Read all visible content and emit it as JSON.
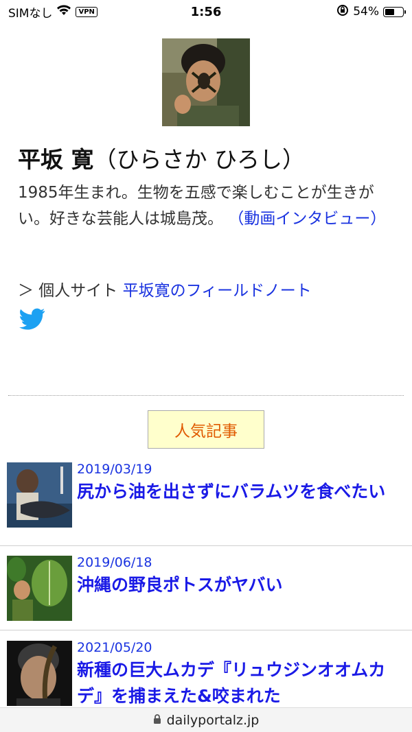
{
  "status_bar": {
    "carrier": "SIMなし",
    "vpn": "VPN",
    "time": "1:56",
    "battery": "54%",
    "battery_level": 0.54
  },
  "profile": {
    "name": "平坂 寛",
    "reading": "（ひらさか ひろし）",
    "bio_text": "1985年生まれ。生物を五感で楽しむことが生きがい。好きな芸能人は城島茂。",
    "bio_link": "（動画インタビュー）",
    "site_prefix": "＞ 個人サイト",
    "site_link": "平坂寛のフィールドノート",
    "twitter_icon": "twitter-icon"
  },
  "popular": {
    "label": "人気記事"
  },
  "articles": [
    {
      "date": "2019/03/19",
      "title": "尻から油を出さずにバラムツを食べたい"
    },
    {
      "date": "2019/06/18",
      "title": "沖縄の野良ポトスがヤバい"
    },
    {
      "date": "2021/05/20",
      "title": "新種の巨大ムカデ『リュウジンオオムカデ』を捕まえた&咬まれた"
    }
  ],
  "url_bar": {
    "domain": "dailyportalz.jp",
    "icon": "lock-icon"
  },
  "colors": {
    "link": "#1a33e0",
    "article_title": "#1a1ae6",
    "popular_bg": "#ffffcc",
    "popular_text": "#e05a00",
    "twitter": "#1da1f2"
  }
}
